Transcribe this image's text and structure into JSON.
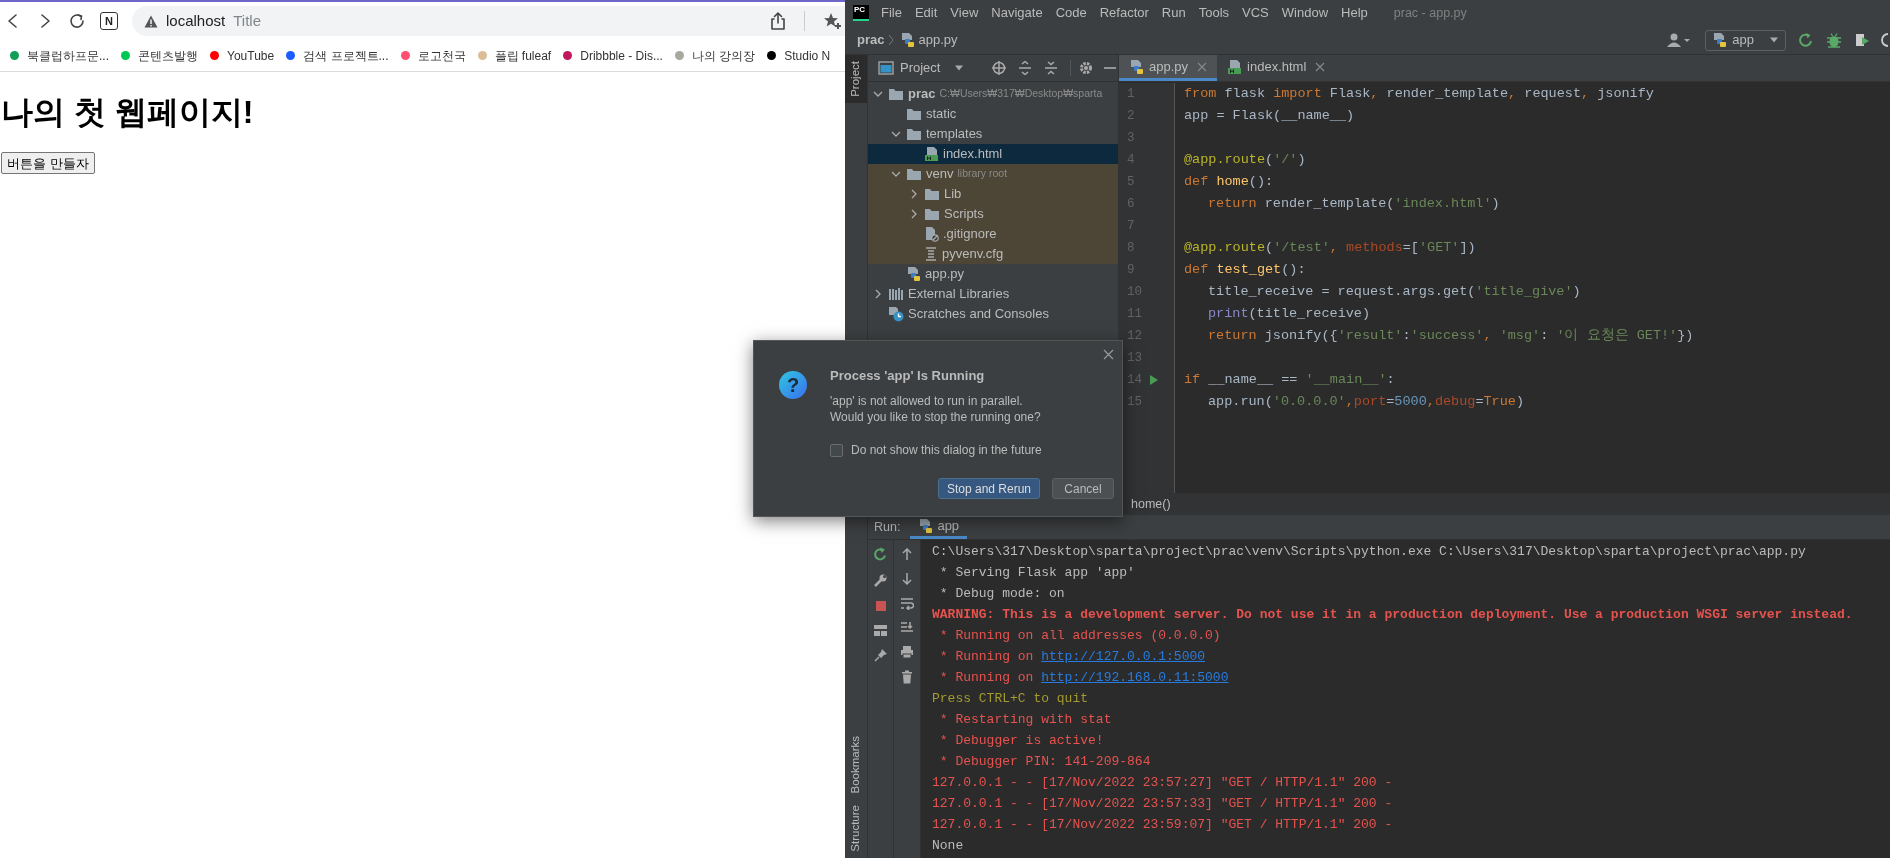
{
  "browser": {
    "extension_badge": "N",
    "address": {
      "host": "localhost",
      "title": "Title"
    },
    "bookmarks": [
      {
        "label": "북클럽하프문...",
        "color": "#0f9d58"
      },
      {
        "label": "콘텐츠발행",
        "color": "#00c853"
      },
      {
        "label": "YouTube",
        "color": "#ff0000"
      },
      {
        "label": "검색 프로젝트...",
        "color": "#1a5cff"
      },
      {
        "label": "로고천국",
        "color": "#ff4f70"
      },
      {
        "label": "플립 fuleaf",
        "color": "#dbbd96"
      },
      {
        "label": "Dribbble - Dis...",
        "color": "#c2185b"
      },
      {
        "label": "나의 강의장",
        "color": "#a8a8a0"
      },
      {
        "label": "Studio N",
        "color": "#000000"
      }
    ],
    "page": {
      "heading": "나의 첫 웹페이지!",
      "button": "버튼을 만들자"
    }
  },
  "ide": {
    "logo": "PC",
    "menu": [
      "File",
      "Edit",
      "View",
      "Navigate",
      "Code",
      "Refactor",
      "Run",
      "Tools",
      "VCS",
      "Window",
      "Help"
    ],
    "window_title": "prac - app.py",
    "breadcrumb": [
      "prac",
      "app.py"
    ],
    "run_config": "app",
    "side_tabs": [
      {
        "label": "Project",
        "selected": true,
        "kind": "top"
      },
      {
        "label": "Bookmarks",
        "selected": false,
        "kind": "bottom"
      },
      {
        "label": "Structure",
        "selected": false,
        "kind": "bottom"
      }
    ],
    "project_panel": {
      "title": "Project",
      "tree": [
        {
          "label": "prac",
          "hint": "C:₩Users₩317₩Desktop₩sparta",
          "kind": "folder",
          "expanded": true,
          "selected": false,
          "children": [
            {
              "label": "static",
              "kind": "folder",
              "selected": false
            },
            {
              "label": "templates",
              "kind": "folder",
              "expanded": true,
              "selected": false,
              "children": [
                {
                  "label": "index.html",
                  "kind": "html",
                  "selected": true
                }
              ]
            },
            {
              "label": "venv",
              "hint": "library root",
              "kind": "library-folder",
              "expanded": true,
              "selected": false,
              "children": [
                {
                  "label": "Lib",
                  "kind": "folder",
                  "expanded": false,
                  "selected": false
                },
                {
                  "label": "Scripts",
                  "kind": "folder",
                  "expanded": false,
                  "selected": false
                },
                {
                  "label": ".gitignore",
                  "kind": "ignore",
                  "selected": false
                },
                {
                  "label": "pyvenv.cfg",
                  "kind": "text",
                  "selected": false
                }
              ]
            },
            {
              "label": "app.py",
              "kind": "python",
              "selected": false
            }
          ]
        },
        {
          "label": "External Libraries",
          "kind": "libraries",
          "expanded": false,
          "selected": false
        },
        {
          "label": "Scratches and Consoles",
          "kind": "scratches",
          "selected": false
        }
      ]
    },
    "editor_tabs": [
      {
        "label": "app.py",
        "kind": "python",
        "selected": true
      },
      {
        "label": "index.html",
        "kind": "html",
        "selected": false
      }
    ],
    "code_lines": [
      {
        "number": "1",
        "indented": false,
        "tokens": [
          {
            "text": "from",
            "kind": "keyword"
          },
          {
            "text": " flask ",
            "kind": "plain"
          },
          {
            "text": "import",
            "kind": "keyword"
          },
          {
            "text": " Flask",
            "kind": "plain"
          },
          {
            "text": ",",
            "kind": "keyword"
          },
          {
            "text": " render_template",
            "kind": "plain"
          },
          {
            "text": ",",
            "kind": "keyword"
          },
          {
            "text": " request",
            "kind": "plain"
          },
          {
            "text": ",",
            "kind": "keyword"
          },
          {
            "text": " jsonify",
            "kind": "plain"
          }
        ]
      },
      {
        "number": "2",
        "indented": false,
        "tokens": [
          {
            "text": "app = Flask(__name__)",
            "kind": "plain"
          }
        ]
      },
      {
        "number": "3"
      },
      {
        "number": "4",
        "indented": false,
        "tokens": [
          {
            "text": "@app.route",
            "kind": "decorator"
          },
          {
            "text": "(",
            "kind": "plain"
          },
          {
            "text": "'/'",
            "kind": "string"
          },
          {
            "text": ")",
            "kind": "plain"
          }
        ]
      },
      {
        "number": "5",
        "indented": false,
        "tokens": [
          {
            "text": "def ",
            "kind": "keyword"
          },
          {
            "text": "home",
            "kind": "function"
          },
          {
            "text": "():",
            "kind": "plain"
          }
        ]
      },
      {
        "number": "6",
        "indented": true,
        "tokens": [
          {
            "text": "return",
            "kind": "keyword"
          },
          {
            "text": " render_template(",
            "kind": "plain"
          },
          {
            "text": "'index.html'",
            "kind": "string"
          },
          {
            "text": ")",
            "kind": "plain"
          }
        ]
      },
      {
        "number": "7"
      },
      {
        "number": "8",
        "indented": false,
        "tokens": [
          {
            "text": "@app.route",
            "kind": "decorator"
          },
          {
            "text": "(",
            "kind": "plain"
          },
          {
            "text": "'/test'",
            "kind": "string"
          },
          {
            "text": ", ",
            "kind": "keyword"
          },
          {
            "text": "methods",
            "kind": "param"
          },
          {
            "text": "=[",
            "kind": "plain"
          },
          {
            "text": "'GET'",
            "kind": "string"
          },
          {
            "text": "])",
            "kind": "plain"
          }
        ]
      },
      {
        "number": "9",
        "indented": false,
        "tokens": [
          {
            "text": "def ",
            "kind": "keyword"
          },
          {
            "text": "test_get",
            "kind": "function"
          },
          {
            "text": "():",
            "kind": "plain"
          }
        ]
      },
      {
        "number": "10",
        "indented": true,
        "tokens": [
          {
            "text": "title_receive = request.args.get(",
            "kind": "plain"
          },
          {
            "text": "'title_give'",
            "kind": "string"
          },
          {
            "text": ")",
            "kind": "plain"
          }
        ]
      },
      {
        "number": "11",
        "indented": true,
        "tokens": [
          {
            "text": "print",
            "kind": "builtin"
          },
          {
            "text": "(title_receive)",
            "kind": "plain"
          }
        ]
      },
      {
        "number": "12",
        "indented": true,
        "tokens": [
          {
            "text": "return",
            "kind": "keyword"
          },
          {
            "text": " jsonify({",
            "kind": "plain"
          },
          {
            "text": "'result'",
            "kind": "string"
          },
          {
            "text": ":",
            "kind": "plain"
          },
          {
            "text": "'success'",
            "kind": "string"
          },
          {
            "text": ", ",
            "kind": "keyword"
          },
          {
            "text": "'msg'",
            "kind": "string"
          },
          {
            "text": ": ",
            "kind": "plain"
          },
          {
            "text": "'이 요청은 GET!'",
            "kind": "string"
          },
          {
            "text": "})",
            "kind": "plain"
          }
        ]
      },
      {
        "number": "13"
      },
      {
        "number": "14",
        "indented": false,
        "run_marker": true,
        "tokens": [
          {
            "text": "if",
            "kind": "keyword"
          },
          {
            "text": " __name__ == ",
            "kind": "plain"
          },
          {
            "text": "'__main__'",
            "kind": "string"
          },
          {
            "text": ":",
            "kind": "plain"
          }
        ]
      },
      {
        "number": "15",
        "indented": true,
        "tokens": [
          {
            "text": "app.run(",
            "kind": "plain"
          },
          {
            "text": "'0.0.0.0'",
            "kind": "string"
          },
          {
            "text": ",",
            "kind": "keyword"
          },
          {
            "text": "port",
            "kind": "param"
          },
          {
            "text": "=",
            "kind": "plain"
          },
          {
            "text": "5000",
            "kind": "number"
          },
          {
            "text": ",",
            "kind": "keyword"
          },
          {
            "text": "debug",
            "kind": "param"
          },
          {
            "text": "=",
            "kind": "plain"
          },
          {
            "text": "True",
            "kind": "keyword"
          },
          {
            "text": ")",
            "kind": "plain"
          }
        ]
      }
    ],
    "editor_breadcrumb": "home()",
    "run_panel": {
      "label": "Run:",
      "tab": "app",
      "console": [
        {
          "kind": "plain",
          "text": "C:\\Users\\317\\Desktop\\sparta\\project\\prac\\venv\\Scripts\\python.exe C:\\Users\\317\\Desktop\\sparta\\project\\prac\\app.py"
        },
        {
          "kind": "plain",
          "text": " * Serving Flask app 'app'"
        },
        {
          "kind": "plain",
          "text": " * Debug mode: on"
        },
        {
          "kind": "error-bold",
          "text": "WARNING: This is a development server. Do not use it in a production deployment. Use a production WSGI server instead."
        },
        {
          "kind": "error",
          "text": " * Running on all addresses (0.0.0.0)"
        },
        {
          "kind": "link",
          "text": " * Running on ",
          "link": "http://127.0.0.1:5000"
        },
        {
          "kind": "link",
          "text": " * Running on ",
          "link": "http://192.168.0.11:5000"
        },
        {
          "kind": "warning",
          "text": "Press CTRL+C to quit"
        },
        {
          "kind": "error",
          "text": " * Restarting with stat"
        },
        {
          "kind": "error",
          "text": " * Debugger is active!"
        },
        {
          "kind": "error",
          "text": " * Debugger PIN: 141-209-864"
        },
        {
          "kind": "error",
          "text": "127.0.0.1 - - [17/Nov/2022 23:57:27] \"GET / HTTP/1.1\" 200 -"
        },
        {
          "kind": "error",
          "text": "127.0.0.1 - - [17/Nov/2022 23:57:33] \"GET / HTTP/1.1\" 200 -"
        },
        {
          "kind": "error",
          "text": "127.0.0.1 - - [17/Nov/2022 23:59:07] \"GET / HTTP/1.1\" 200 -"
        },
        {
          "kind": "plain",
          "text": "None"
        }
      ]
    }
  },
  "dialog": {
    "icon_glyph": "?",
    "title": "Process 'app' Is Running",
    "message": [
      "'app' is not allowed to run in parallel.",
      "Would you like to stop the running one?"
    ],
    "checkbox": {
      "label": "Do not show this dialog in the future",
      "checked": false
    },
    "buttons": [
      {
        "label": "Stop and Rerun",
        "kind": "primary"
      },
      {
        "label": "Cancel",
        "kind": "secondary"
      }
    ]
  }
}
